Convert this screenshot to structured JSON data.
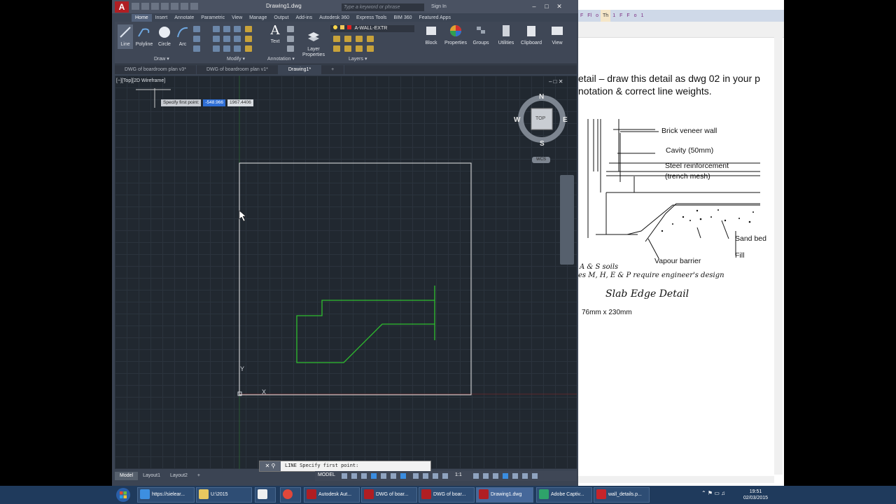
{
  "autocad": {
    "doc_title": "Drawing1.dwg",
    "search_placeholder": "Type a keyword or phrase",
    "sign_in": "Sign In",
    "ribbon_tabs": [
      "Home",
      "Insert",
      "Annotate",
      "Parametric",
      "View",
      "Manage",
      "Output",
      "Add-ins",
      "Autodesk 360",
      "Express Tools",
      "BIM 360",
      "Featured Apps"
    ],
    "active_tab": "Home",
    "draw_tools": [
      "Line",
      "Polyline",
      "Circle",
      "Arc"
    ],
    "text_tool": "Text",
    "layer_properties": "Layer\nProperties",
    "layer_current": "A-WALL-EXTR",
    "right_tools": [
      "Block",
      "Properties",
      "Groups",
      "Utilities",
      "Clipboard",
      "View"
    ],
    "panel_titles": {
      "draw": "Draw ▾",
      "modify": "Modify ▾",
      "annotation": "Annotation ▾",
      "layers": "Layers ▾"
    },
    "file_tabs": [
      "DWG of boardroom plan v3*",
      "DWG of boardroom plan v1*",
      "Drawing1*"
    ],
    "viewport_label": "[−][Top][2D Wireframe]",
    "tooltip": {
      "label": "Specify first point:",
      "x": "-548.966",
      "y": "1967.4406"
    },
    "viewcube": {
      "n": "N",
      "s": "S",
      "e": "E",
      "w": "W",
      "top": "TOP"
    },
    "wcs": "WCS",
    "command_prompt": "LINE Specify first point:",
    "layout_tabs": [
      "Model",
      "Layout1",
      "Layout2"
    ],
    "status_model": "MODEL",
    "scale": "1:1",
    "colors": {
      "green_line": "#2fbf2f",
      "rect": "#e8e8e8",
      "viewport_bg": "#212830"
    }
  },
  "pdf": {
    "tabs": [
      "F",
      "Fl",
      "o",
      "Th",
      "1",
      "F",
      "F",
      "o",
      "1"
    ],
    "heading_line1": "etail – draw this detail as dwg 02 in your p",
    "heading_line2": "notation & correct line weights.",
    "labels": {
      "brick": "Brick veneer wall",
      "cavity": "Cavity (50mm)",
      "steel1": "Steel reinforcement",
      "steel2": "(trench mesh)",
      "sand": "Sand bed",
      "fill": "Fill",
      "vapour": "Vapour barrier",
      "soils": "A & S soils",
      "engineer": "es M, H, E & P require engineer's design",
      "caption": "Slab Edge Detail",
      "size": "76mm x 230mm"
    }
  },
  "taskbar": {
    "items": [
      "https://sielear...",
      "U:\\2015",
      "",
      "",
      "Autodesk Aut...",
      "DWG of boar...",
      "DWG of boar...",
      "Drawing1.dwg",
      "Adobe Captiv...",
      "wall_details.p..."
    ],
    "time": "19:51",
    "date": "02/03/2015"
  }
}
